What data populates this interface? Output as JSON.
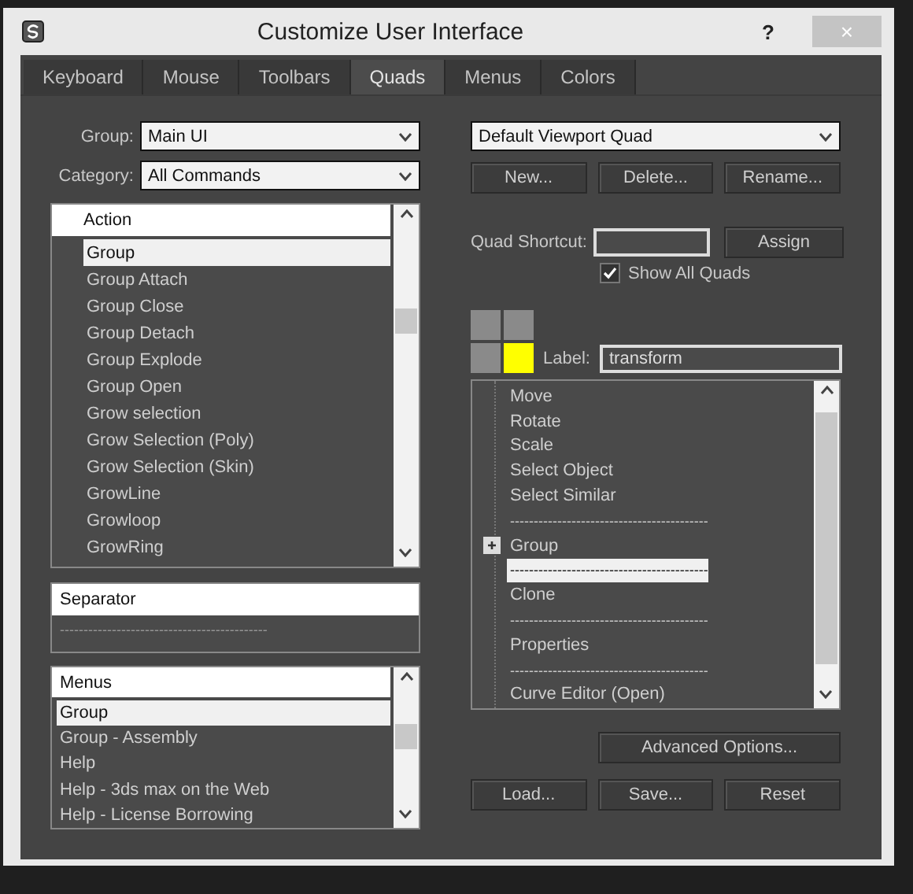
{
  "window": {
    "title": "Customize User Interface",
    "help": "?",
    "close": "×"
  },
  "tabs": [
    {
      "label": "Keyboard",
      "selected": false
    },
    {
      "label": "Mouse",
      "selected": false
    },
    {
      "label": "Toolbars",
      "selected": false
    },
    {
      "label": "Quads",
      "selected": true
    },
    {
      "label": "Menus",
      "selected": false
    },
    {
      "label": "Colors",
      "selected": false
    }
  ],
  "group": {
    "label": "Group:",
    "value": "Main UI"
  },
  "category": {
    "label": "Category:",
    "value": "All Commands"
  },
  "actions": {
    "header": "Action",
    "items": [
      {
        "label": "Group",
        "selected": true
      },
      {
        "label": "Group Attach",
        "selected": false
      },
      {
        "label": "Group Close",
        "selected": false
      },
      {
        "label": "Group Detach",
        "selected": false
      },
      {
        "label": "Group Explode",
        "selected": false
      },
      {
        "label": "Group Open",
        "selected": false
      },
      {
        "label": "Grow selection",
        "selected": false
      },
      {
        "label": "Grow Selection (Poly)",
        "selected": false
      },
      {
        "label": "Grow Selection (Skin)",
        "selected": false
      },
      {
        "label": "GrowLine",
        "selected": false
      },
      {
        "label": "Growloop",
        "selected": false
      },
      {
        "label": "GrowRing",
        "selected": false
      }
    ]
  },
  "separators": {
    "header": "Separator",
    "items": [
      "--------------------------------------------"
    ]
  },
  "menus": {
    "header": "Menus",
    "items": [
      {
        "label": "Group",
        "selected": true
      },
      {
        "label": "Group - Assembly",
        "selected": false
      },
      {
        "label": "Help",
        "selected": false
      },
      {
        "label": "Help - 3ds max on the Web",
        "selected": false
      },
      {
        "label": "Help - License Borrowing",
        "selected": false
      }
    ]
  },
  "quad_set": {
    "value": "Default Viewport Quad"
  },
  "set_buttons": [
    "New...",
    "Delete...",
    "Rename..."
  ],
  "shortcut": {
    "label": "Quad Shortcut:",
    "button": "Assign"
  },
  "show_all_quads": {
    "label": "Show All Quads",
    "checked": true
  },
  "quads": [
    {
      "selected": false
    },
    {
      "selected": false
    },
    {
      "selected": false
    },
    {
      "selected": true
    }
  ],
  "quad_label": {
    "label": "Label:",
    "value": "transform"
  },
  "quad_items": [
    {
      "label": "Move",
      "selected": false,
      "kind": "command"
    },
    {
      "label": "Rotate",
      "selected": false,
      "kind": "command"
    },
    {
      "label": "Scale",
      "selected": false,
      "kind": "command"
    },
    {
      "label": "Select Object",
      "selected": false,
      "kind": "command"
    },
    {
      "label": "Select Similar",
      "selected": false,
      "kind": "command"
    },
    {
      "label": "------------------------------------------",
      "selected": false,
      "kind": "separator"
    },
    {
      "label": "Group",
      "selected": false,
      "kind": "submenu",
      "expanded": false
    },
    {
      "label": "------------------------------------------",
      "selected": true,
      "kind": "separator"
    },
    {
      "label": "Clone",
      "selected": false,
      "kind": "command"
    },
    {
      "label": "------------------------------------------",
      "selected": false,
      "kind": "separator"
    },
    {
      "label": "Properties",
      "selected": false,
      "kind": "command"
    },
    {
      "label": "------------------------------------------",
      "selected": false,
      "kind": "separator"
    },
    {
      "label": "Curve Editor (Open)",
      "selected": false,
      "kind": "command"
    }
  ],
  "advanced_button": "Advanced Options...",
  "bottom_buttons": [
    "Load...",
    "Save...",
    "Reset"
  ]
}
